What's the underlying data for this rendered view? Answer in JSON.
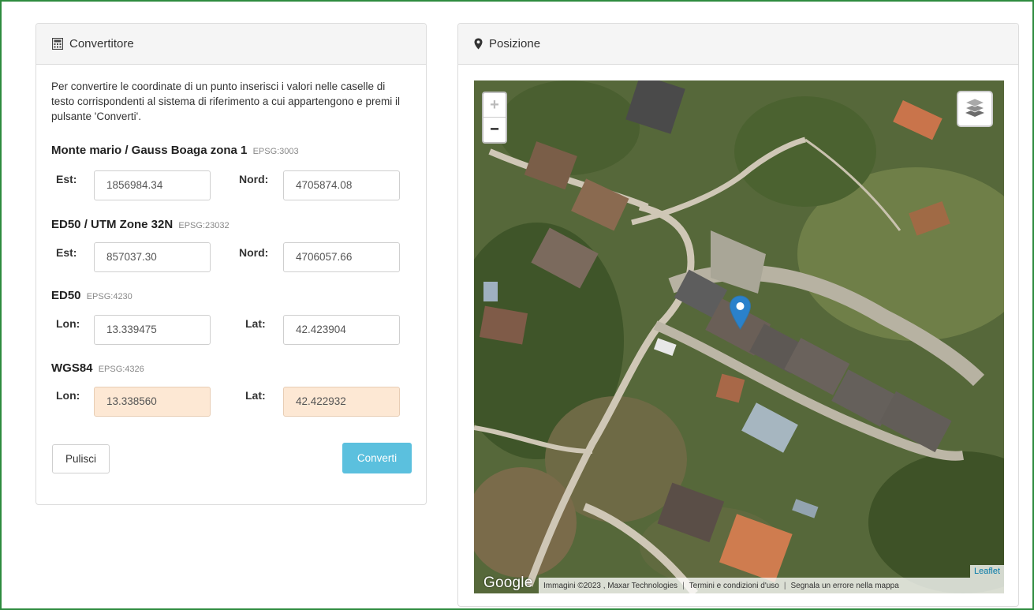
{
  "converter": {
    "title": "Convertitore",
    "intro": "Per convertire le coordinate di un punto inserisci i valori nelle caselle di testo corrispondenti al sistema di riferimento a cui appartengono e premi il pulsante 'Converti'.",
    "systems": [
      {
        "name": "Monte mario / Gauss Boaga zona 1",
        "epsg": "EPSG:3003",
        "label1": "Est:",
        "value1": "1856984.34",
        "label2": "Nord:",
        "value2": "4705874.08"
      },
      {
        "name": "ED50 / UTM Zone 32N",
        "epsg": "EPSG:23032",
        "label1": "Est:",
        "value1": "857037.30",
        "label2": "Nord:",
        "value2": "4706057.66"
      },
      {
        "name": "ED50",
        "epsg": "EPSG:4230",
        "label1": "Lon:",
        "value1": "13.339475",
        "label2": "Lat:",
        "value2": "42.423904"
      },
      {
        "name": "WGS84",
        "epsg": "EPSG:4326",
        "label1": "Lon:",
        "value1": "13.338560",
        "label2": "Lat:",
        "value2": "42.422932"
      }
    ],
    "clear_label": "Pulisci",
    "convert_label": "Converti"
  },
  "position": {
    "title": "Posizione",
    "zoom_in": "+",
    "zoom_out": "−",
    "google_logo": "Google",
    "leaflet": "Leaflet",
    "attribution": [
      "Immagini ©2023 , Maxar Technologies",
      "Termini e condizioni d'uso",
      "Segnala un errore nella mappa"
    ]
  },
  "icons": {
    "calculator": "calculator-icon",
    "marker": "map-marker-icon",
    "layers": "layers-icon"
  },
  "colors": {
    "frame": "#2e8b3e",
    "convert_button": "#5bc0de",
    "readonly_input": "#fde8d4",
    "pin": "#2a81cb"
  }
}
